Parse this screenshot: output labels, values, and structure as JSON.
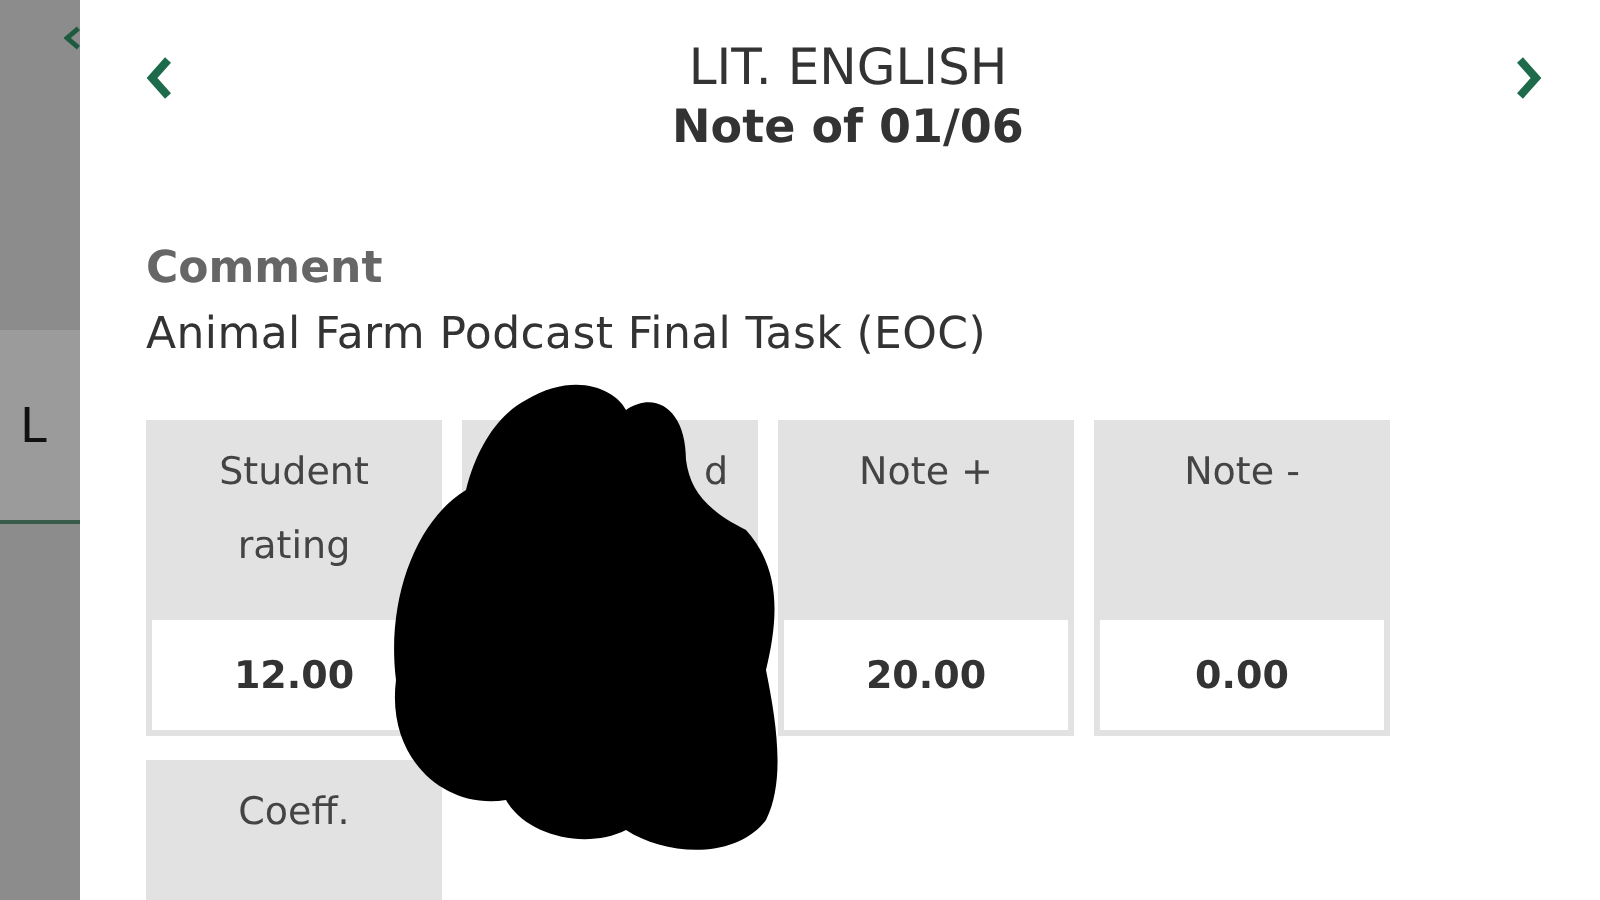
{
  "backdrop": {
    "letter": "L"
  },
  "header": {
    "subject": "LIT. ENGLISH",
    "subtitle": "Note of 01/06"
  },
  "comment": {
    "label": "Comment",
    "text": "Animal Farm Podcast Final Task (EOC)"
  },
  "cells": [
    {
      "kind": "value",
      "label": "Student rating",
      "value": "12.00"
    },
    {
      "kind": "redacted",
      "label": "d"
    },
    {
      "kind": "value",
      "label": "Note +",
      "value": "20.00"
    },
    {
      "kind": "value",
      "label": "Note -",
      "value": "0.00"
    },
    {
      "kind": "label",
      "label": "Coeff."
    }
  ]
}
